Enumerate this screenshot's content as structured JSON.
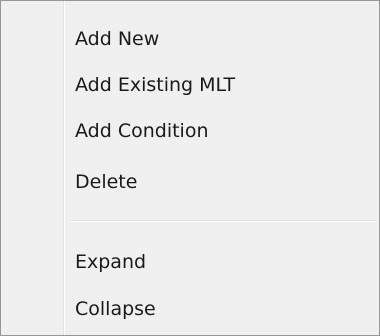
{
  "context_menu": {
    "items": [
      {
        "label": "Add New"
      },
      {
        "label": "Add Existing MLT"
      },
      {
        "label": "Add Condition"
      },
      {
        "label": "Delete"
      }
    ],
    "items_after_separator": [
      {
        "label": "Expand"
      },
      {
        "label": "Collapse"
      }
    ]
  }
}
